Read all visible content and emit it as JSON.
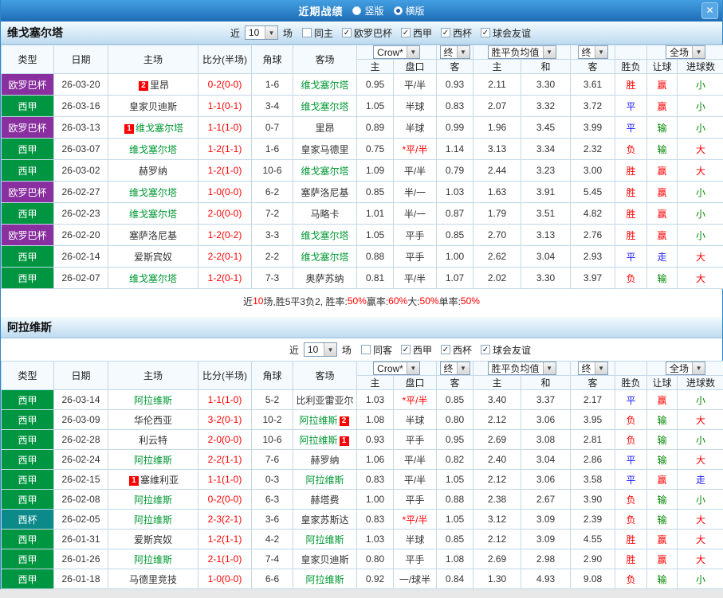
{
  "titlebar": {
    "title": "近期战绩",
    "vertical_label": "竖版",
    "horizontal_label": "横版"
  },
  "icons": {
    "check": "✓",
    "dropdown_arrow": "▼",
    "close": "✕"
  },
  "colors": {
    "featured_team": "#009933",
    "plain_team": "#333333",
    "score": "#ff0000",
    "badge_bg": "#ff0000",
    "league": {
      "欧罗巴杯": "#8a2f9f",
      "西甲": "#009540",
      "西杯": "#0c8a8a"
    },
    "result": {
      "胜": "#ff0000",
      "平": "#1a1aff",
      "负": "#ff0000",
      "赢": "#ff0000",
      "输": "#008800",
      "走": "#1a1aff",
      "大": "#ff0000",
      "小": "#008800"
    }
  },
  "table_header": {
    "type": "类型",
    "date": "日期",
    "home": "主场",
    "score": "比分(半场)",
    "corners": "角球",
    "away": "客场",
    "odds_source": "Crow*",
    "final1": "终",
    "avg": "胜平负均值",
    "final2": "终",
    "full": "全场",
    "sub": [
      "主",
      "盘口",
      "客",
      "主",
      "和",
      "客",
      "胜负",
      "让球",
      "进球数"
    ]
  },
  "sections": [
    {
      "team": "维戈塞尔塔",
      "filter": {
        "near": "近",
        "count": "10",
        "games": "场",
        "same": {
          "label": "同主",
          "checked": false
        },
        "leagues": [
          {
            "label": "欧罗巴杯",
            "checked": true
          },
          {
            "label": "西甲",
            "checked": true
          },
          {
            "label": "西杯",
            "checked": true
          },
          {
            "label": "球会友谊",
            "checked": true
          }
        ]
      },
      "rows": [
        {
          "league": "欧罗巴杯",
          "date": "26-03-20",
          "home": {
            "name": "里昂",
            "featured": false,
            "badge": "2",
            "badge_side": "left"
          },
          "score": "0-2(0-0)",
          "corners": "1-6",
          "away": {
            "name": "维戈塞尔塔",
            "featured": true
          },
          "odds": [
            "0.95",
            "平/半",
            "0.93"
          ],
          "handicap_red": false,
          "avg": [
            "2.11",
            "3.30",
            "3.61"
          ],
          "results": [
            "胜",
            "赢",
            "小"
          ]
        },
        {
          "league": "西甲",
          "date": "26-03-16",
          "home": {
            "name": "皇家贝迪斯",
            "featured": false
          },
          "score": "1-1(0-1)",
          "corners": "3-4",
          "away": {
            "name": "维戈塞尔塔",
            "featured": true
          },
          "odds": [
            "1.05",
            "半球",
            "0.83"
          ],
          "handicap_red": false,
          "avg": [
            "2.07",
            "3.32",
            "3.72"
          ],
          "results": [
            "平",
            "赢",
            "小"
          ]
        },
        {
          "league": "欧罗巴杯",
          "date": "26-03-13",
          "home": {
            "name": "维戈塞尔塔",
            "featured": true,
            "badge": "1",
            "badge_side": "left"
          },
          "score": "1-1(1-0)",
          "corners": "0-7",
          "away": {
            "name": "里昂",
            "featured": false
          },
          "odds": [
            "0.89",
            "半球",
            "0.99"
          ],
          "handicap_red": false,
          "avg": [
            "1.96",
            "3.45",
            "3.99"
          ],
          "results": [
            "平",
            "输",
            "小"
          ]
        },
        {
          "league": "西甲",
          "date": "26-03-07",
          "home": {
            "name": "维戈塞尔塔",
            "featured": true
          },
          "score": "1-2(1-1)",
          "corners": "1-6",
          "away": {
            "name": "皇家马德里",
            "featured": false
          },
          "odds": [
            "0.75",
            "*平/半",
            "1.14"
          ],
          "handicap_red": true,
          "avg": [
            "3.13",
            "3.34",
            "2.32"
          ],
          "results": [
            "负",
            "输",
            "大"
          ]
        },
        {
          "league": "西甲",
          "date": "26-03-02",
          "home": {
            "name": "赫罗纳",
            "featured": false
          },
          "score": "1-2(1-0)",
          "corners": "10-6",
          "away": {
            "name": "维戈塞尔塔",
            "featured": true
          },
          "odds": [
            "1.09",
            "平/半",
            "0.79"
          ],
          "handicap_red": false,
          "avg": [
            "2.44",
            "3.23",
            "3.00"
          ],
          "results": [
            "胜",
            "赢",
            "大"
          ]
        },
        {
          "league": "欧罗巴杯",
          "date": "26-02-27",
          "home": {
            "name": "维戈塞尔塔",
            "featured": true
          },
          "score": "1-0(0-0)",
          "corners": "6-2",
          "away": {
            "name": "塞萨洛尼基",
            "featured": false
          },
          "odds": [
            "0.85",
            "半/一",
            "1.03"
          ],
          "handicap_red": false,
          "avg": [
            "1.63",
            "3.91",
            "5.45"
          ],
          "results": [
            "胜",
            "赢",
            "小"
          ]
        },
        {
          "league": "西甲",
          "date": "26-02-23",
          "home": {
            "name": "维戈塞尔塔",
            "featured": true
          },
          "score": "2-0(0-0)",
          "corners": "7-2",
          "away": {
            "name": "马略卡",
            "featured": false
          },
          "odds": [
            "1.01",
            "半/一",
            "0.87"
          ],
          "handicap_red": false,
          "avg": [
            "1.79",
            "3.51",
            "4.82"
          ],
          "results": [
            "胜",
            "赢",
            "小"
          ]
        },
        {
          "league": "欧罗巴杯",
          "date": "26-02-20",
          "home": {
            "name": "塞萨洛尼基",
            "featured": false
          },
          "score": "1-2(0-2)",
          "corners": "3-3",
          "away": {
            "name": "维戈塞尔塔",
            "featured": true
          },
          "odds": [
            "1.05",
            "平手",
            "0.85"
          ],
          "handicap_red": false,
          "avg": [
            "2.70",
            "3.13",
            "2.76"
          ],
          "results": [
            "胜",
            "赢",
            "小"
          ]
        },
        {
          "league": "西甲",
          "date": "26-02-14",
          "home": {
            "name": "爱斯宾奴",
            "featured": false
          },
          "score": "2-2(0-1)",
          "corners": "2-2",
          "away": {
            "name": "维戈塞尔塔",
            "featured": true
          },
          "odds": [
            "0.88",
            "平手",
            "1.00"
          ],
          "handicap_red": false,
          "avg": [
            "2.62",
            "3.04",
            "2.93"
          ],
          "results": [
            "平",
            "走",
            "大"
          ]
        },
        {
          "league": "西甲",
          "date": "26-02-07",
          "home": {
            "name": "维戈塞尔塔",
            "featured": true
          },
          "score": "1-2(0-1)",
          "corners": "7-3",
          "away": {
            "name": "奥萨苏纳",
            "featured": false
          },
          "odds": [
            "0.81",
            "平/半",
            "1.07"
          ],
          "handicap_red": false,
          "avg": [
            "2.02",
            "3.30",
            "3.97"
          ],
          "results": [
            "负",
            "输",
            "大"
          ]
        }
      ],
      "summary": [
        {
          "text": "近",
          "color": "#333333"
        },
        {
          "text": "10",
          "color": "#ff0000"
        },
        {
          "text": "场,胜5平3负2, 胜率:",
          "color": "#333333"
        },
        {
          "text": "50%",
          "color": "#ff0000"
        },
        {
          "text": " 赢率:",
          "color": "#333333"
        },
        {
          "text": "60%",
          "color": "#ff0000"
        },
        {
          "text": " 大:",
          "color": "#333333"
        },
        {
          "text": "50%",
          "color": "#ff0000"
        },
        {
          "text": " 单率:",
          "color": "#333333"
        },
        {
          "text": "50%",
          "color": "#ff0000"
        }
      ]
    },
    {
      "team": "阿拉维斯",
      "filter": {
        "near": "近",
        "count": "10",
        "games": "场",
        "same": {
          "label": "同客",
          "checked": false
        },
        "leagues": [
          {
            "label": "西甲",
            "checked": true
          },
          {
            "label": "西杯",
            "checked": true
          },
          {
            "label": "球会友谊",
            "checked": true
          }
        ]
      },
      "rows": [
        {
          "league": "西甲",
          "date": "26-03-14",
          "home": {
            "name": "阿拉维斯",
            "featured": true
          },
          "score": "1-1(1-0)",
          "corners": "5-2",
          "away": {
            "name": "比利亚雷亚尔",
            "featured": false
          },
          "odds": [
            "1.03",
            "*平/半",
            "0.85"
          ],
          "handicap_red": true,
          "avg": [
            "3.40",
            "3.37",
            "2.17"
          ],
          "results": [
            "平",
            "赢",
            "小"
          ]
        },
        {
          "league": "西甲",
          "date": "26-03-09",
          "home": {
            "name": "华伦西亚",
            "featured": false
          },
          "score": "3-2(0-1)",
          "corners": "10-2",
          "away": {
            "name": "阿拉维斯",
            "featured": true,
            "badge": "2",
            "badge_side": "right"
          },
          "odds": [
            "1.08",
            "半球",
            "0.80"
          ],
          "handicap_red": false,
          "avg": [
            "2.12",
            "3.06",
            "3.95"
          ],
          "results": [
            "负",
            "输",
            "大"
          ]
        },
        {
          "league": "西甲",
          "date": "26-02-28",
          "home": {
            "name": "利云特",
            "featured": false
          },
          "score": "2-0(0-0)",
          "corners": "10-6",
          "away": {
            "name": "阿拉维斯",
            "featured": true,
            "badge": "1",
            "badge_side": "right"
          },
          "odds": [
            "0.93",
            "平手",
            "0.95"
          ],
          "handicap_red": false,
          "avg": [
            "2.69",
            "3.08",
            "2.81"
          ],
          "results": [
            "负",
            "输",
            "小"
          ]
        },
        {
          "league": "西甲",
          "date": "26-02-24",
          "home": {
            "name": "阿拉维斯",
            "featured": true
          },
          "score": "2-2(1-1)",
          "corners": "7-6",
          "away": {
            "name": "赫罗纳",
            "featured": false
          },
          "odds": [
            "1.06",
            "平/半",
            "0.82"
          ],
          "handicap_red": false,
          "avg": [
            "2.40",
            "3.04",
            "2.86"
          ],
          "results": [
            "平",
            "输",
            "大"
          ]
        },
        {
          "league": "西甲",
          "date": "26-02-15",
          "home": {
            "name": "塞维利亚",
            "featured": false,
            "badge": "1",
            "badge_side": "left"
          },
          "score": "1-1(1-0)",
          "corners": "0-3",
          "away": {
            "name": "阿拉维斯",
            "featured": true
          },
          "odds": [
            "0.83",
            "平/半",
            "1.05"
          ],
          "handicap_red": false,
          "avg": [
            "2.12",
            "3.06",
            "3.58"
          ],
          "results": [
            "平",
            "赢",
            "走"
          ]
        },
        {
          "league": "西甲",
          "date": "26-02-08",
          "home": {
            "name": "阿拉维斯",
            "featured": true
          },
          "score": "0-2(0-0)",
          "corners": "6-3",
          "away": {
            "name": "赫塔费",
            "featured": false
          },
          "odds": [
            "1.00",
            "平手",
            "0.88"
          ],
          "handicap_red": false,
          "avg": [
            "2.38",
            "2.67",
            "3.90"
          ],
          "results": [
            "负",
            "输",
            "小"
          ]
        },
        {
          "league": "西杯",
          "date": "26-02-05",
          "home": {
            "name": "阿拉维斯",
            "featured": true
          },
          "score": "2-3(2-1)",
          "corners": "3-6",
          "away": {
            "name": "皇家苏斯达",
            "featured": false
          },
          "odds": [
            "0.83",
            "*平/半",
            "1.05"
          ],
          "handicap_red": true,
          "avg": [
            "3.12",
            "3.09",
            "2.39"
          ],
          "results": [
            "负",
            "输",
            "大"
          ]
        },
        {
          "league": "西甲",
          "date": "26-01-31",
          "home": {
            "name": "爱斯宾奴",
            "featured": false
          },
          "score": "1-2(1-1)",
          "corners": "4-2",
          "away": {
            "name": "阿拉维斯",
            "featured": true
          },
          "odds": [
            "1.03",
            "半球",
            "0.85"
          ],
          "handicap_red": false,
          "avg": [
            "2.12",
            "3.09",
            "4.55"
          ],
          "results": [
            "胜",
            "赢",
            "大"
          ]
        },
        {
          "league": "西甲",
          "date": "26-01-26",
          "home": {
            "name": "阿拉维斯",
            "featured": true
          },
          "score": "2-1(1-0)",
          "corners": "7-4",
          "away": {
            "name": "皇家贝迪斯",
            "featured": false
          },
          "odds": [
            "0.80",
            "平手",
            "1.08"
          ],
          "handicap_red": false,
          "avg": [
            "2.69",
            "2.98",
            "2.90"
          ],
          "results": [
            "胜",
            "赢",
            "大"
          ]
        },
        {
          "league": "西甲",
          "date": "26-01-18",
          "home": {
            "name": "马德里竞技",
            "featured": false
          },
          "score": "1-0(0-0)",
          "corners": "6-6",
          "away": {
            "name": "阿拉维斯",
            "featured": true
          },
          "odds": [
            "0.92",
            "一/球半",
            "0.84"
          ],
          "handicap_red": false,
          "avg": [
            "1.30",
            "4.93",
            "9.08"
          ],
          "results": [
            "负",
            "输",
            "小"
          ]
        }
      ]
    }
  ]
}
